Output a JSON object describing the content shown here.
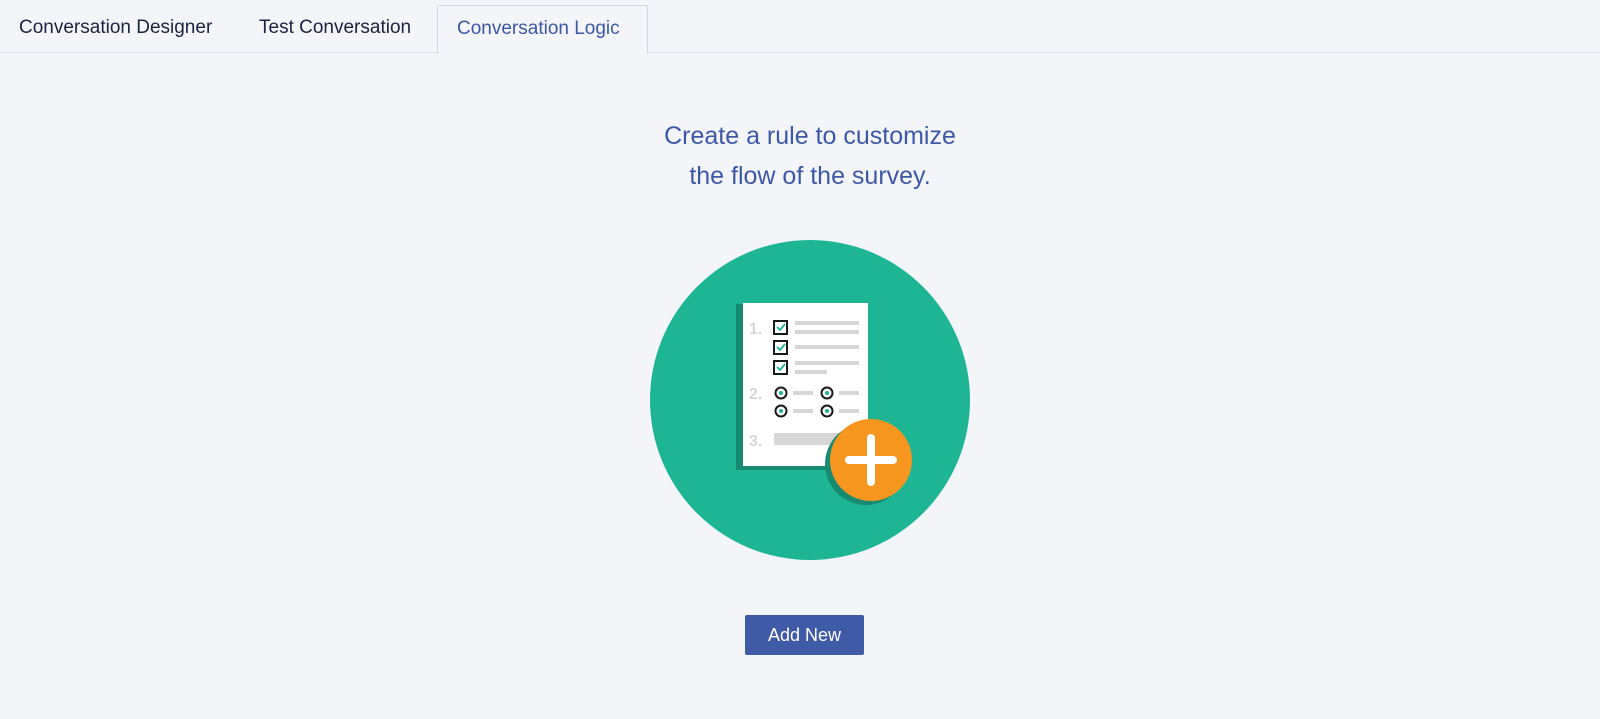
{
  "tabs": [
    {
      "label": "Conversation Designer",
      "active": false
    },
    {
      "label": "Test Conversation",
      "active": false
    },
    {
      "label": "Conversation Logic",
      "active": true
    }
  ],
  "empty_state": {
    "headline_line1": "Create a rule to customize",
    "headline_line2": "the flow of the survey.",
    "illustration_icon": "survey-add-icon",
    "list_numbers": [
      "1.",
      "2.",
      "3."
    ],
    "add_button_label": "Add New"
  },
  "colors": {
    "accent": "#3d58a6",
    "button": "#3f5aa6",
    "illustration_circle": "#1eb595",
    "plus_badge": "#f6961f"
  }
}
